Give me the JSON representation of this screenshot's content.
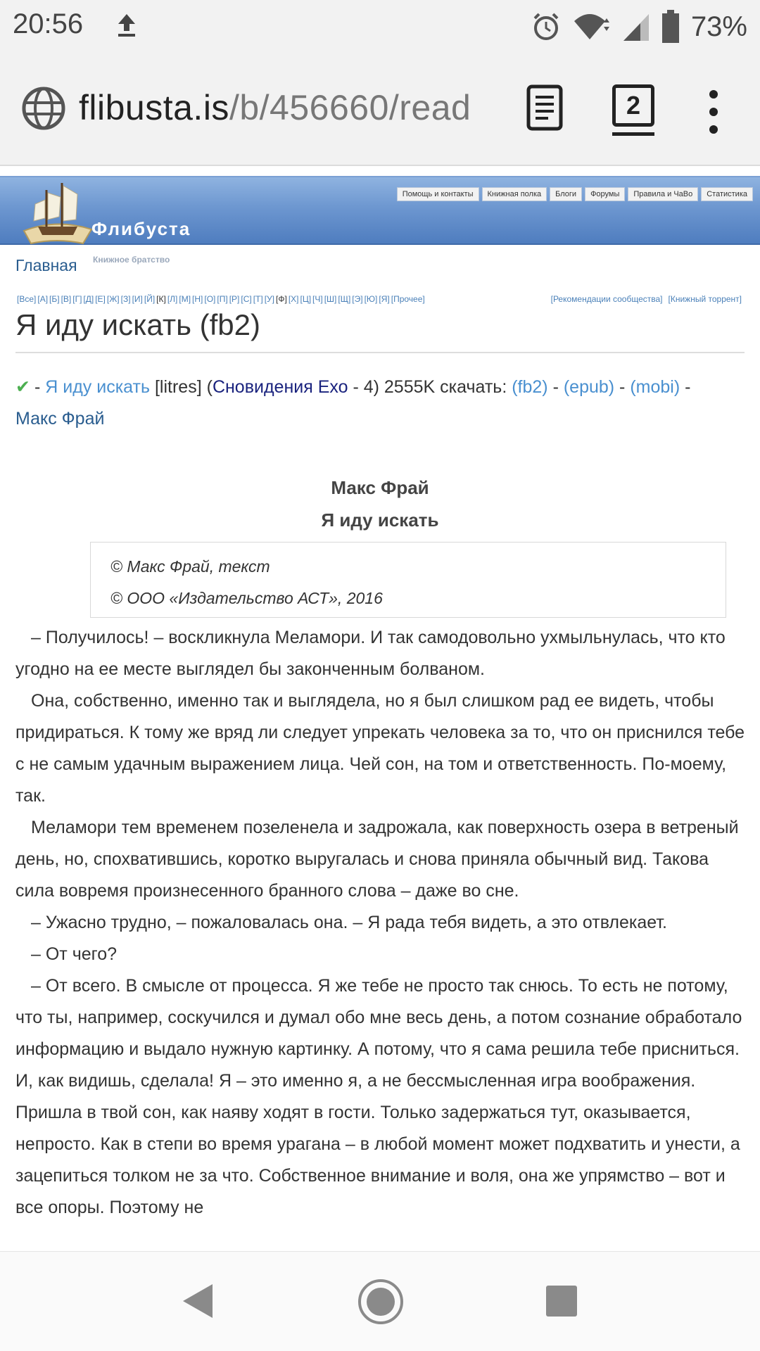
{
  "status_bar": {
    "time": "20:56",
    "battery": "73%",
    "icons": [
      "upload-icon",
      "alarm-icon",
      "wifi-icon",
      "signal-icon",
      "battery-icon"
    ]
  },
  "browser": {
    "url_domain": "flibusta.is",
    "url_path": "/b/456660/read",
    "tab_count": "2",
    "icons": [
      "globe-icon",
      "reader-mode-icon",
      "tabs-icon",
      "overflow-menu-icon"
    ]
  },
  "site": {
    "name": "Флибуста",
    "slogan": "Книжное братство",
    "home": "Главная",
    "topnav": [
      "Помощь и контакты",
      "Книжная полка",
      "Блоги",
      "Форумы",
      "Правила и ЧаВо",
      "Статистика"
    ],
    "alphabet": [
      "[Все]",
      "[А]",
      "[Б]",
      "[В]",
      "[Г]",
      "[Д]",
      "[Е]",
      "[Ж]",
      "[З]",
      "[И]",
      "[Й]",
      "[К]",
      "[Л]",
      "[М]",
      "[Н]",
      "[О]",
      "[П]",
      "[Р]",
      "[С]",
      "[Т]",
      "[У]",
      "[Ф]",
      "[Х]",
      "[Ц]",
      "[Ч]",
      "[Ш]",
      "[Щ]",
      "[Э]",
      "[Ю]",
      "[Я]",
      "[Прочее]"
    ],
    "recommend_links": [
      "[Рекомендации сообщества]",
      "[Книжный торрент]"
    ]
  },
  "page": {
    "title": "Я иду искать (fb2)",
    "book_line": {
      "prefix": "-",
      "book_link": "Я иду искать",
      "publisher": "[litres]",
      "open_paren": "(",
      "series": "Сновидения Ехо",
      "series_rest": " - 4) 2555K скачать: ",
      "fb2": "(fb2)",
      "epub": "(epub)",
      "mobi": "(mobi)",
      "sep": " - ",
      "author": "Макс Фрай"
    },
    "book_author": "Макс Фрай",
    "book_title": "Я иду искать",
    "copyright": [
      "© Макс Фрай, текст",
      "© ООО «Издательство АСТ», 2016"
    ],
    "paragraphs": [
      "– Получилось! – воскликнула Меламори. И так самодовольно ухмыльнулась, что кто угодно на ее месте выглядел бы законченным болваном.",
      "Она, собственно, именно так и выглядела, но я был слишком рад ее видеть, чтобы придираться. К тому же вряд ли следует упрекать человека за то, что он приснился тебе с не самым удачным выражением лица. Чей сон, на том и ответственность. По-моему, так.",
      "Меламори тем временем позеленела и задрожала, как поверхность озера в ветреный день, но, спохватившись, коротко выругалась и снова приняла обычный вид. Такова сила вовремя произнесенного бранного слова – даже во сне.",
      "– Ужасно трудно, – пожаловалась она. – Я рада тебя видеть, а это отвлекает.",
      "– От чего?",
      "– От всего. В смысле от процесса. Я же тебе не просто так снюсь. То есть не потому, что ты, например, соскучился и думал обо мне весь день, а потом сознание обработало информацию и выдало нужную картинку. А потому, что я сама решила тебе присниться. И, как видишь, сделала! Я – это именно я, а не бессмысленная игра воображения. Пришла в твой сон, как наяву ходят в гости. Только задержаться тут, оказывается, непросто. Как в степи во время урагана – в любой момент может подхватить и унести, а зацепиться толком не за что. Собственное внимание и воля, она же упрямство – вот и все опоры. Поэтому не"
    ]
  },
  "nav_bar": {
    "icons": [
      "back-icon",
      "home-icon",
      "recent-apps-icon"
    ]
  }
}
